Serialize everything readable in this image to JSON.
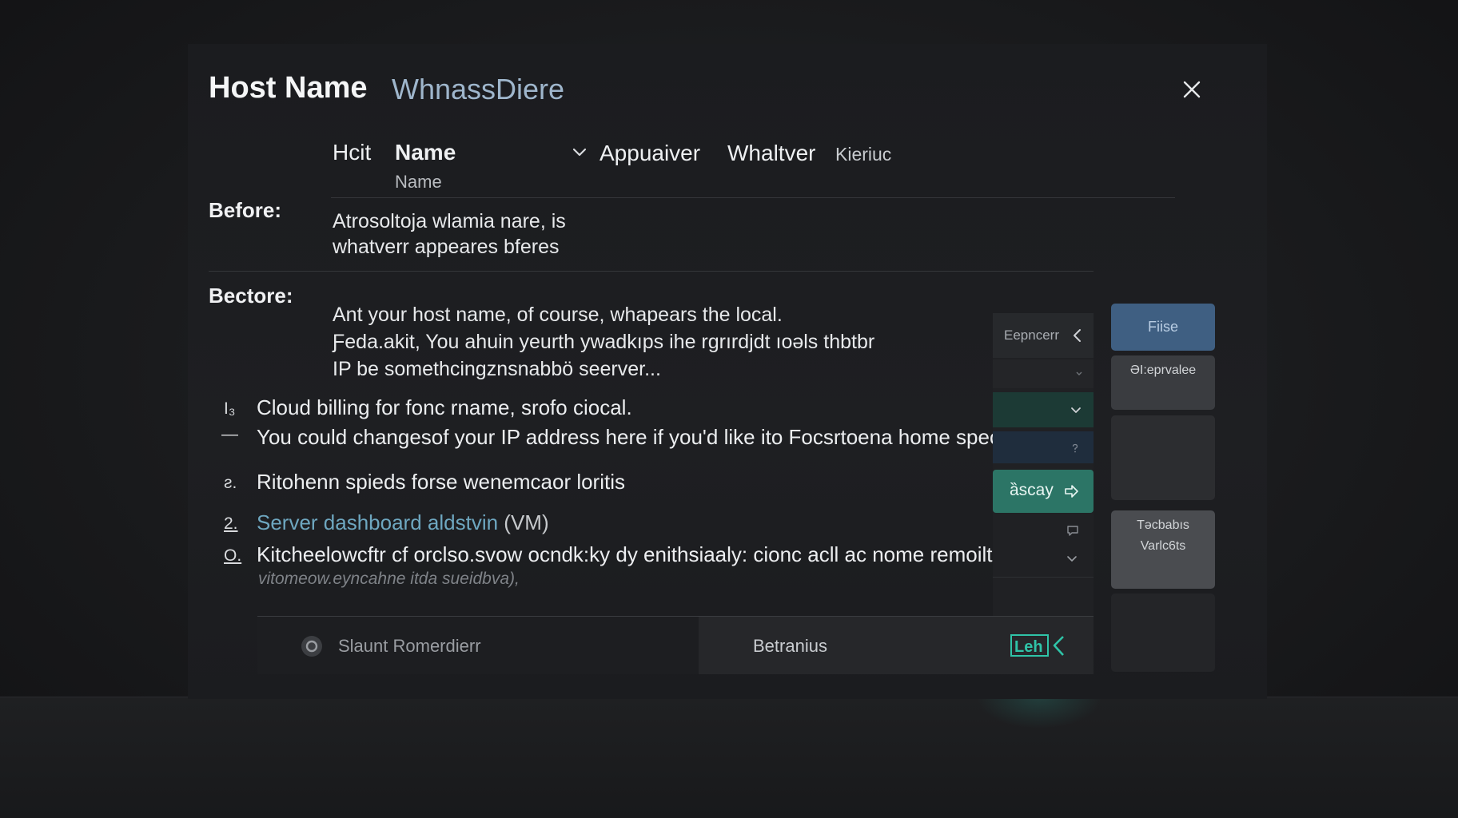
{
  "dialog": {
    "title": "Host Name",
    "subtitle": "WhnassDiere",
    "close_icon": "close-icon"
  },
  "columns": {
    "col1": "Hcit",
    "col2": "Name",
    "col2_sub": "Name",
    "col3": "Appuaiver",
    "col4": "Whaltver",
    "col5": "Kieriuc"
  },
  "before": {
    "label": "Before:",
    "line1": "Atrosoltoja wlamia nare, is",
    "line2": "whatverr appeares bferes"
  },
  "bectore": {
    "label": "Bectore:",
    "line1": "Ant your host name, of course, whapears the local.",
    "line2": "Ƒeda.akit, You ahuin yeurth ywadkıps ihe rgrırdjdt ıoəls thbtbr",
    "line3": "IP be  somethcingznsnabbö seerver..."
  },
  "list": [
    {
      "marker": "I₃",
      "text": "Cloud billing for fonc rname, srofo ciocal."
    },
    {
      "marker": "—",
      "text": "You could changesof your IP address here if you'd like ito Focsrtoena home specific"
    },
    {
      "marker": "ƨ.",
      "text": "Ritohenn spieds forse wenemcaor loritis"
    },
    {
      "marker": "2.",
      "text": "Server dashboard aldstvin",
      "suffix": "(VM)"
    },
    {
      "marker": "O.",
      "text": "Kitcheelowcftr cf orclso.svow ocndk:ky dy enithsiaaly: cionc acll ac nome remoiltes."
    }
  ],
  "list_note": "vitomeow.eyncahne itda sueidbva),",
  "side_panel": {
    "explore_label": "Eepncerr",
    "action_label": "ȁscay"
  },
  "tiles": {
    "files": "Fiise",
    "es": "ƏI:eprvalee",
    "var_line1": "Tǝcbabıs",
    "var_line2": "Varlc6ts"
  },
  "footer": {
    "left_label": "Slaunt Romerdierr",
    "right_label": "Betranius",
    "logo_text": "Leh"
  },
  "colors": {
    "accent_teal": "#2c7566",
    "accent_blue": "#3f5f82",
    "link": "#6ea7c0",
    "subtitle": "#9fb6cc",
    "logo": "#2fc4a8"
  }
}
